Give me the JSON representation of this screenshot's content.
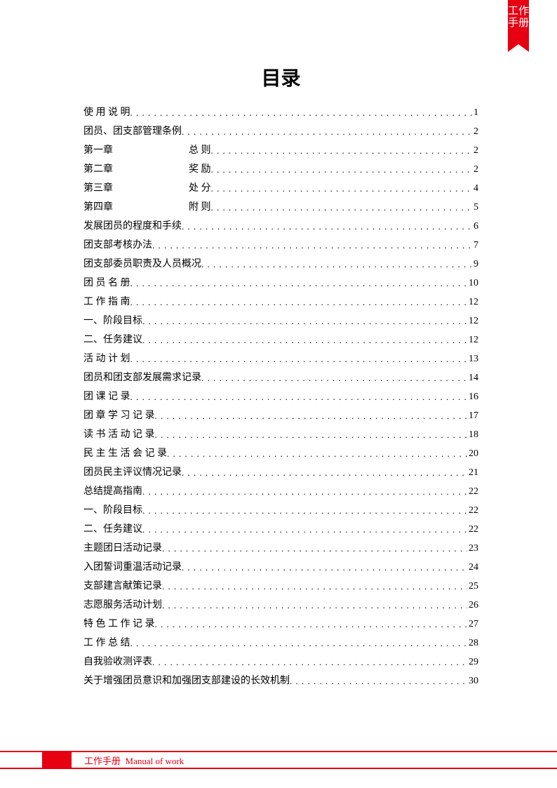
{
  "ribbon": "工作手册",
  "title": "目录",
  "toc": [
    {
      "prefix": "",
      "label": "使 用 说 明",
      "page": "1"
    },
    {
      "prefix": "",
      "label": "团员、团支部管理条例",
      "page": "2"
    },
    {
      "prefix": "第一章",
      "label": "总 则",
      "page": "2"
    },
    {
      "prefix": "第二章",
      "label": "奖 励",
      "page": "2"
    },
    {
      "prefix": "第三章",
      "label": "处 分",
      "page": "4"
    },
    {
      "prefix": "第四章",
      "label": "附 则",
      "page": "5"
    },
    {
      "prefix": "",
      "label": "发展团员的程度和手续",
      "page": "6"
    },
    {
      "prefix": "",
      "label": "团支部考核办法",
      "page": "7"
    },
    {
      "prefix": "",
      "label": "团支部委员职责及人员概况",
      "page": "9"
    },
    {
      "prefix": "",
      "label": "团 员 名 册",
      "page": "10"
    },
    {
      "prefix": "",
      "label": "工 作 指 南",
      "page": "12"
    },
    {
      "prefix": "",
      "label": "一、阶段目标",
      "page": "12"
    },
    {
      "prefix": "",
      "label": "二、任务建议",
      "page": "12"
    },
    {
      "prefix": "",
      "label": "活 动 计 划",
      "page": "13"
    },
    {
      "prefix": "",
      "label": "团员和团支部发展需求记录",
      "page": "14"
    },
    {
      "prefix": "",
      "label": "团 课 记 录",
      "page": "16"
    },
    {
      "prefix": "",
      "label": "团 章 学 习 记 录",
      "page": "17"
    },
    {
      "prefix": "",
      "label": "读 书 活 动 记 录",
      "page": "18"
    },
    {
      "prefix": "",
      "label": "民 主 生 活 会 记 录",
      "page": "20"
    },
    {
      "prefix": "",
      "label": "团员民主评议情况记录",
      "page": "21"
    },
    {
      "prefix": "",
      "label": "总结提高指南",
      "page": "22"
    },
    {
      "prefix": "",
      "label": "一、阶段目标",
      "page": "22"
    },
    {
      "prefix": "",
      "label": "二、任务建议",
      "page": "22"
    },
    {
      "prefix": "",
      "label": "主题团日活动记录",
      "page": "23"
    },
    {
      "prefix": "",
      "label": "入团誓词重温活动记录",
      "page": "24"
    },
    {
      "prefix": "",
      "label": "支部建言献策记录",
      "page": "25"
    },
    {
      "prefix": "",
      "label": "志愿服务活动计划",
      "page": "26"
    },
    {
      "prefix": "",
      "label": "特 色 工 作 记 录",
      "page": "27"
    },
    {
      "prefix": "",
      "label": "工 作 总 结",
      "page": "28"
    },
    {
      "prefix": "",
      "label": "自我验收测评表",
      "page": "29"
    },
    {
      "prefix": "",
      "label": "关于增强团员意识和加强团支部建设的长效机制",
      "page": "30"
    }
  ],
  "footer": {
    "label_cn": "工作手册",
    "label_en": "Manual of work"
  }
}
